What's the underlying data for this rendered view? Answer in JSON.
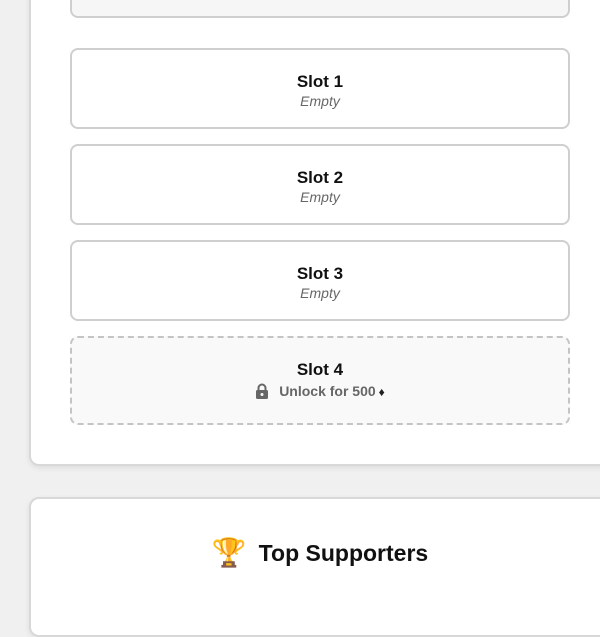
{
  "slots": [
    {
      "title": "Slot 1",
      "status": "Empty"
    },
    {
      "title": "Slot 2",
      "status": "Empty"
    },
    {
      "title": "Slot 3",
      "status": "Empty"
    }
  ],
  "locked_slot": {
    "title": "Slot 4",
    "unlock_label": "Unlock for 500",
    "currency_icon": "diamond-icon",
    "lock_icon": "lock-icon"
  },
  "supporters": {
    "title": "Top Supporters",
    "icon": "trophy-icon"
  },
  "colors": {
    "card_bg": "#ffffff",
    "page_bg": "#f0f0f0",
    "border": "#cfcfcf",
    "muted_text": "#666666"
  }
}
